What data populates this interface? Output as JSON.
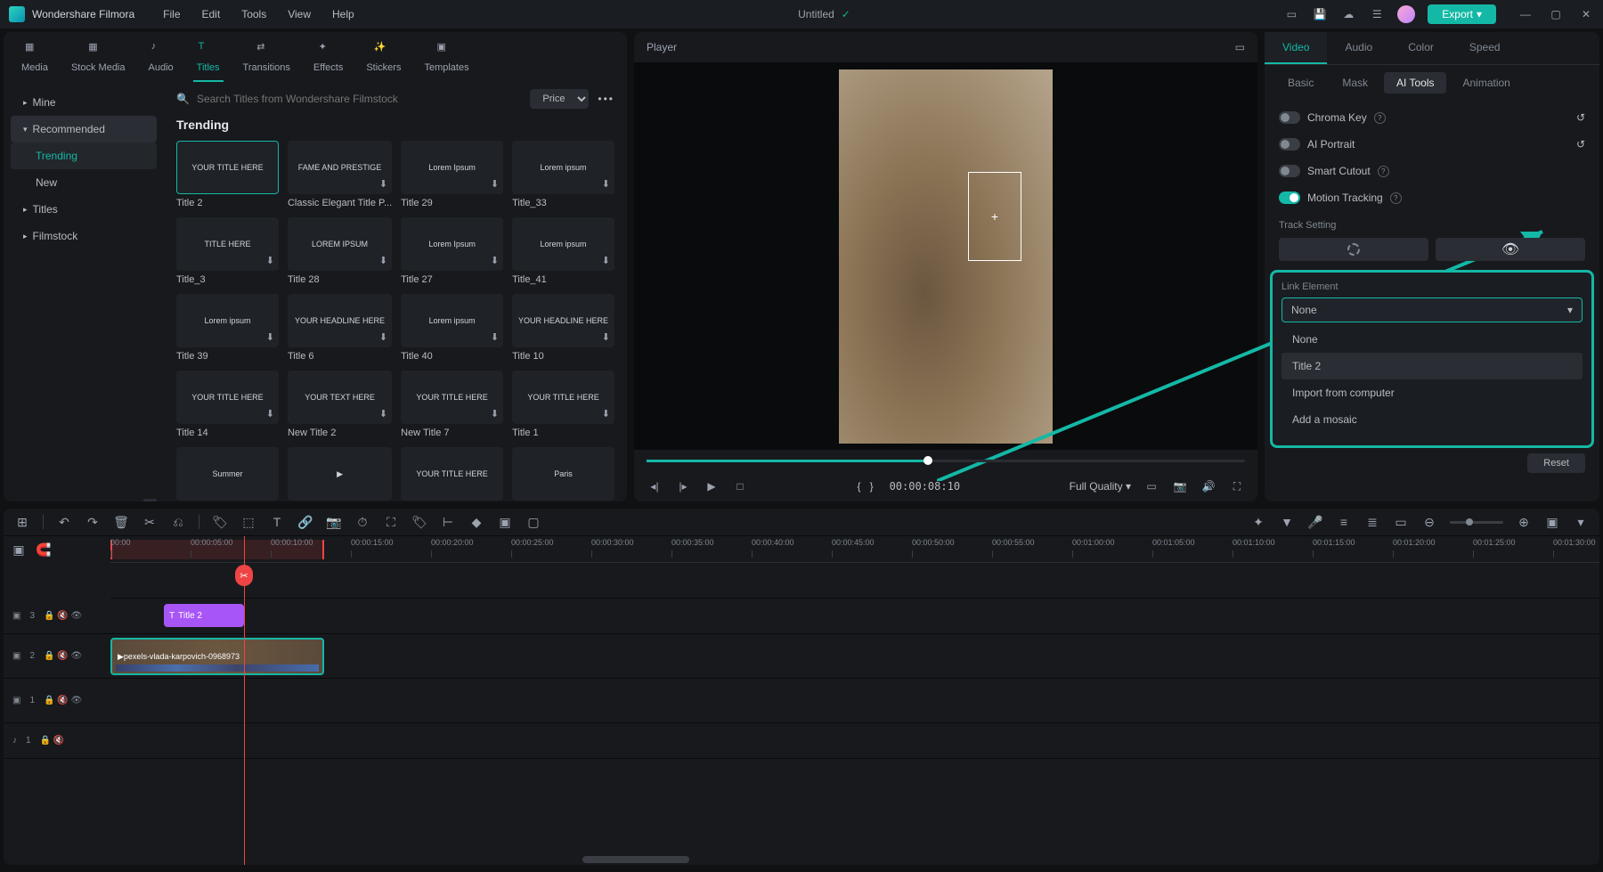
{
  "app": {
    "name": "Wondershare Filmora",
    "doc_title": "Untitled"
  },
  "menu": [
    "File",
    "Edit",
    "Tools",
    "View",
    "Help"
  ],
  "export_label": "Export",
  "asset_tabs": [
    {
      "label": "Media"
    },
    {
      "label": "Stock Media"
    },
    {
      "label": "Audio"
    },
    {
      "label": "Titles",
      "active": true
    },
    {
      "label": "Transitions"
    },
    {
      "label": "Effects"
    },
    {
      "label": "Stickers"
    },
    {
      "label": "Templates"
    }
  ],
  "sidebar": {
    "mine": "Mine",
    "recommended": "Recommended",
    "trending": "Trending",
    "new": "New",
    "titles": "Titles",
    "filmstock": "Filmstock"
  },
  "search": {
    "placeholder": "Search Titles from Wondershare Filmstock",
    "price": "Price"
  },
  "section_title": "Trending",
  "tiles": [
    {
      "label": "Title 2",
      "thumb": "YOUR TITLE HERE",
      "active": true
    },
    {
      "label": "Classic Elegant Title P...",
      "thumb": "FAME AND PRESTIGE",
      "dl": true
    },
    {
      "label": "Title 29",
      "thumb": "Lorem Ipsum",
      "dl": true
    },
    {
      "label": "Title_33",
      "thumb": "Lorem ipsum",
      "dl": true
    },
    {
      "label": "Title_3",
      "thumb": "TITLE HERE",
      "dl": true
    },
    {
      "label": "Title 28",
      "thumb": "LOREM IPSUM",
      "dl": true
    },
    {
      "label": "Title 27",
      "thumb": "Lorem Ipsum",
      "dl": true
    },
    {
      "label": "Title_41",
      "thumb": "Lorem ipsum",
      "dl": true
    },
    {
      "label": "Title 39",
      "thumb": "Lorem ipsum",
      "dl": true
    },
    {
      "label": "Title 6",
      "thumb": "YOUR HEADLINE HERE",
      "dl": true
    },
    {
      "label": "Title 40",
      "thumb": "Lorem ipsum",
      "dl": true
    },
    {
      "label": "Title 10",
      "thumb": "YOUR HEADLINE HERE",
      "dl": true
    },
    {
      "label": "Title 14",
      "thumb": "YOUR TITLE HERE",
      "dl": true
    },
    {
      "label": "New Title 2",
      "thumb": "YOUR TEXT HERE",
      "dl": true
    },
    {
      "label": "New Title 7",
      "thumb": "YOUR TITLE HERE",
      "dl": true
    },
    {
      "label": "Title 1",
      "thumb": "YOUR TITLE HERE",
      "dl": true
    },
    {
      "label": "",
      "thumb": "Summer"
    },
    {
      "label": "",
      "thumb": "▶"
    },
    {
      "label": "",
      "thumb": "YOUR TITLE HERE"
    },
    {
      "label": "",
      "thumb": "Paris"
    }
  ],
  "player": {
    "title": "Player",
    "timecode": "00:00:08:10",
    "quality": "Full Quality"
  },
  "right": {
    "tabs": [
      "Video",
      "Audio",
      "Color",
      "Speed"
    ],
    "subtabs": [
      "Basic",
      "Mask",
      "AI Tools",
      "Animation"
    ],
    "chroma": "Chroma Key",
    "portrait": "AI Portrait",
    "cutout": "Smart Cutout",
    "motion": "Motion Tracking",
    "track_setting": "Track Setting",
    "link_element": "Link Element",
    "link_value": "None",
    "options": [
      "None",
      "Title 2",
      "Import from computer",
      "Add a mosaic"
    ],
    "reset": "Reset"
  },
  "timeline": {
    "ticks": [
      "00:00",
      "00:00:05:00",
      "00:00:10:00",
      "00:00:15:00",
      "00:00:20:00",
      "00:00:25:00",
      "00:00:30:00",
      "00:00:35:00",
      "00:00:40:00",
      "00:00:45:00",
      "00:00:50:00",
      "00:00:55:00",
      "00:01:00:00",
      "00:01:05:00",
      "00:01:10:00",
      "00:01:15:00",
      "00:01:20:00",
      "00:01:25:00",
      "00:01:30:00"
    ],
    "tracks": {
      "t3": "3",
      "t2": "2",
      "t1": "1",
      "a1": "1"
    },
    "title_clip": "Title 2",
    "video_clip": "pexels-vlada-karpovich-0968973"
  }
}
